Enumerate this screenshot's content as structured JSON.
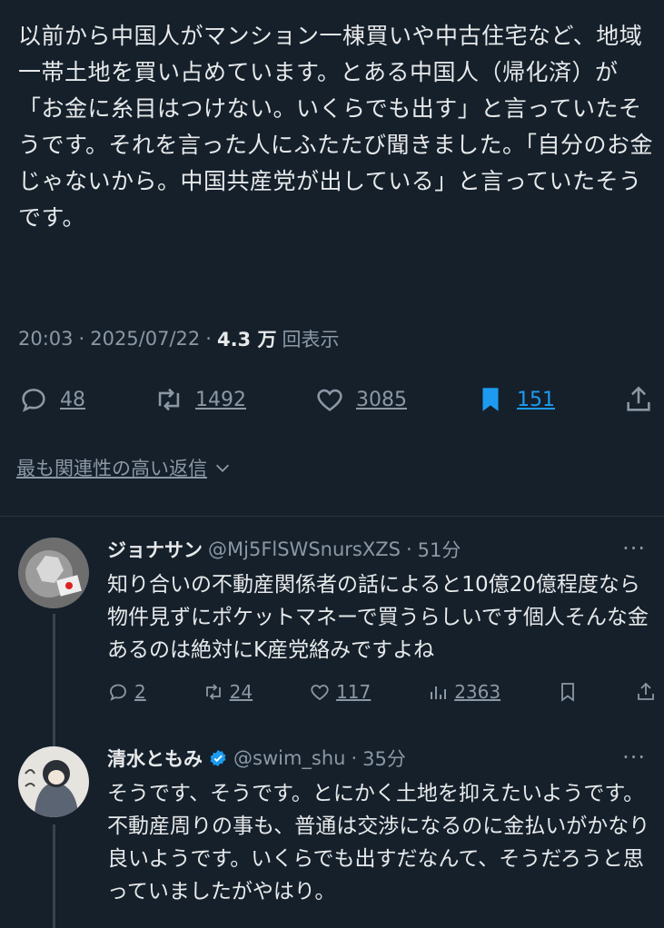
{
  "tweet": {
    "text": "以前から中国人がマンション一棟買いや中古住宅など、地域一帯土地を買い占めています。とある中国人（帰化済）が「お金に糸目はつけない。いくらでも出す」と言っていたそうです。それを言った人にふたたび聞きました。「自分のお金じゃないから。中国共産党が出している」と言っていたそうです。",
    "time": "20:03",
    "date": "2025/07/22",
    "views": "4.3 万",
    "views_label": "回表示"
  },
  "actions": {
    "replies": "48",
    "retweets": "1492",
    "likes": "3085",
    "bookmarks": "151"
  },
  "sort_label": "最も関連性の高い返信",
  "replies": [
    {
      "name": "ジョナサン",
      "handle": "@Mj5FlSWSnursXZS",
      "time": "51分",
      "text": "知り合いの不動産関係者の話によると10億20億程度なら物件見ずにポケットマネーで買うらしいです個人そんな金あるのは絶対にK産党絡みですよね",
      "replies": "2",
      "retweets": "24",
      "likes": "117",
      "views": "2363"
    },
    {
      "name": "清水ともみ",
      "handle": "@swim_shu",
      "time": "35分",
      "text": "そうです、そうです。とにかく土地を抑えたいようです。不動産周りの事も、普通は交渉になるのに金払いがかなり良いようです。いくらでも出すだなんて、そうだろうと思っていましたがやはり。"
    }
  ],
  "colors": {
    "background": "#15202b",
    "text": "#e7e9ea",
    "secondary": "#8b98a5",
    "accent": "#1d9bf0"
  }
}
